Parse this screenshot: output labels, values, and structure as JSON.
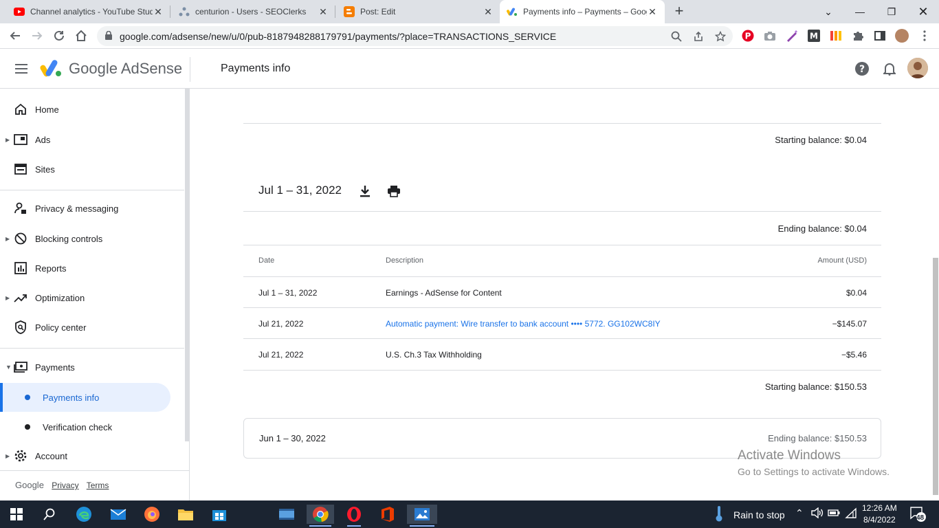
{
  "browser": {
    "tabs": [
      {
        "title": "Channel analytics - YouTube Studio",
        "icon": "youtube-icon"
      },
      {
        "title": "centurion - Users - SEOClerks",
        "icon": "seoclerks-icon"
      },
      {
        "title": "Post: Edit",
        "icon": "blogger-icon"
      },
      {
        "title": "Payments info – Payments – Google AdSense",
        "icon": "adsense-icon"
      }
    ],
    "url": "google.com/adsense/new/u/0/pub-8187948288179791/payments/?place=TRANSACTIONS_SERVICE"
  },
  "header": {
    "brand": "Google AdSense",
    "page_title": "Payments info"
  },
  "sidebar": {
    "items": [
      {
        "label": "Home",
        "icon": "home-icon"
      },
      {
        "label": "Ads",
        "icon": "ads-icon"
      },
      {
        "label": "Sites",
        "icon": "sites-icon"
      },
      {
        "label": "Privacy & messaging",
        "icon": "privacy-icon"
      },
      {
        "label": "Blocking controls",
        "icon": "block-icon"
      },
      {
        "label": "Reports",
        "icon": "reports-icon"
      },
      {
        "label": "Optimization",
        "icon": "trending-icon"
      },
      {
        "label": "Policy center",
        "icon": "policy-icon"
      },
      {
        "label": "Payments",
        "icon": "payments-icon"
      },
      {
        "label": "Account",
        "icon": "gear-icon"
      }
    ],
    "sub_items": [
      {
        "label": "Payments info"
      },
      {
        "label": "Verification check"
      }
    ],
    "footer": {
      "google": "Google",
      "privacy": "Privacy",
      "terms": "Terms"
    }
  },
  "main": {
    "starting_balance_top": "Starting balance: $0.04",
    "period": "Jul 1 – 31, 2022",
    "ending_balance": "Ending balance: $0.04",
    "columns": {
      "date": "Date",
      "description": "Description",
      "amount": "Amount (USD)"
    },
    "rows": [
      {
        "date": "Jul 1 – 31, 2022",
        "description": "Earnings - AdSense for Content",
        "amount": "$0.04"
      },
      {
        "date": "Jul 21, 2022",
        "description": "Automatic payment: Wire transfer to bank account  •••• 5772. GG102WC8IY",
        "amount": "−$145.07"
      },
      {
        "date": "Jul 21, 2022",
        "description": "U.S. Ch.3 Tax Withholding",
        "amount": "−$5.46"
      }
    ],
    "starting_balance_bottom": "Starting balance: $150.53",
    "prev_period": "Jun 1 – 30, 2022",
    "prev_ending": "Ending balance: $150.53"
  },
  "watermark": {
    "line1": "Activate Windows",
    "line2": "Go to Settings to activate Windows."
  },
  "taskbar": {
    "weather": "Rain to stop",
    "time": "12:26 AM",
    "date": "8/4/2022",
    "notifications": "48"
  },
  "colors": {
    "accent": "#1a73e8",
    "active_bg": "#e8f0fe",
    "taskbar": "#1b2431"
  }
}
